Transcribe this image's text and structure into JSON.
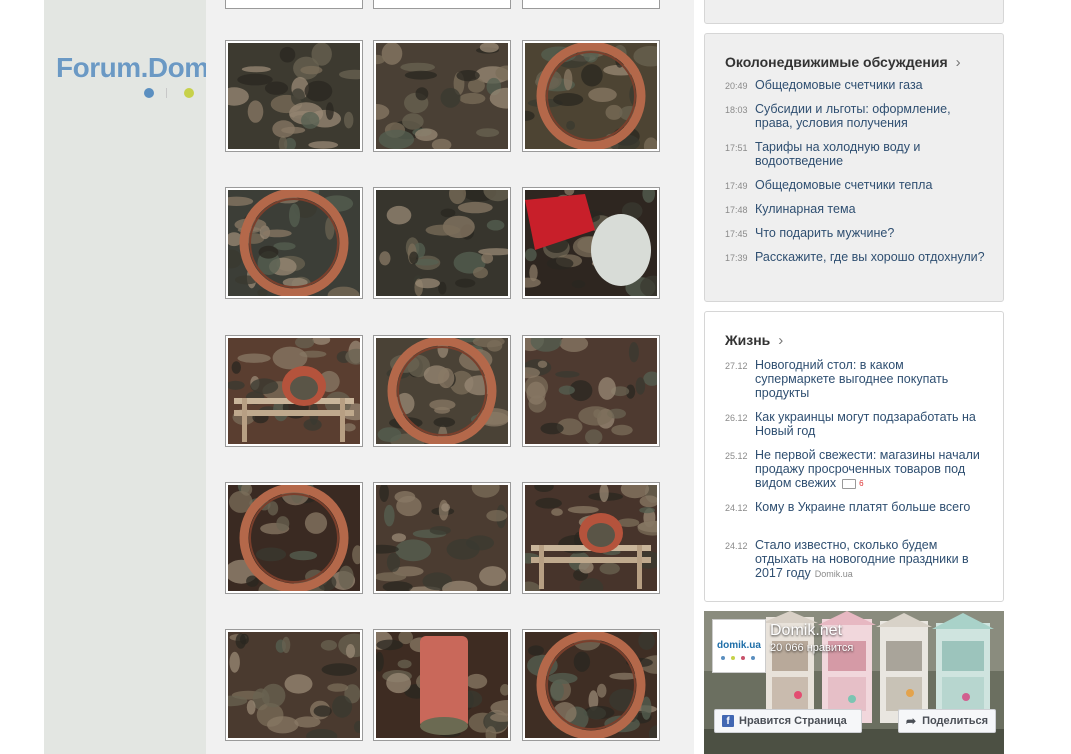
{
  "logo": {
    "text": "Forum.Domik.ua",
    "dot_colors": [
      "#5b8fc0",
      "#c7d14a",
      "#c8536b"
    ]
  },
  "gallery": {
    "photos": [
      {
        "name": "photo-sewage-debris",
        "tone": "#3d3a30"
      },
      {
        "name": "photo-sewage-debris",
        "tone": "#4a4035"
      },
      {
        "name": "photo-pipe-interior",
        "tone": "#4d4433"
      },
      {
        "name": "photo-pipe-cross-section",
        "tone": "#3c3e37"
      },
      {
        "name": "photo-sewage-debris",
        "tone": "#37352d"
      },
      {
        "name": "photo-hand-with-pipe",
        "tone": "#2e2620"
      },
      {
        "name": "photo-pipe-on-bench",
        "tone": "#5a3e30"
      },
      {
        "name": "photo-pipe-cross-section",
        "tone": "#4a4236"
      },
      {
        "name": "photo-sewage-debris",
        "tone": "#4e3a30"
      },
      {
        "name": "photo-pipe-cross-section",
        "tone": "#3a2a22"
      },
      {
        "name": "photo-sewage-debris",
        "tone": "#4b3c31"
      },
      {
        "name": "photo-pipe-on-bench",
        "tone": "#47342b"
      },
      {
        "name": "photo-sewage-debris",
        "tone": "#4a3a2f"
      },
      {
        "name": "photo-pipe-upright",
        "tone": "#3e2c22"
      },
      {
        "name": "photo-pipe-cross-section",
        "tone": "#3f2e24"
      }
    ]
  },
  "discussions": {
    "title": "Околонедвижимые обсуждения",
    "items": [
      {
        "time": "20:49",
        "title": "Общедомовые счетчики газа"
      },
      {
        "time": "18:03",
        "title": "Субсидии и льготы: оформление, права, условия получения"
      },
      {
        "time": "17:51",
        "title": "Тарифы на холодную воду и водоотведение"
      },
      {
        "time": "17:49",
        "title": "Общедомовые счетчики тепла"
      },
      {
        "time": "17:48",
        "title": "Кулинарная тема"
      },
      {
        "time": "17:45",
        "title": "Что подарить мужчине?"
      },
      {
        "time": "17:39",
        "title": "Расскажите, где вы хорошо отдохнули?"
      }
    ]
  },
  "life": {
    "title": "Жизнь",
    "items": [
      {
        "date": "27.12",
        "title": "Новогодний стол: в каком супермаркете выгоднее покупать продукты"
      },
      {
        "date": "26.12",
        "title": "Как украинцы могут подзаработать на Новый год"
      },
      {
        "date": "25.12",
        "title": "Не первой свежести: магазины начали продажу просроченных товаров под видом свежих",
        "comments": "6"
      },
      {
        "date": "24.12",
        "title": "Кому в Украине платят больше всего"
      },
      {
        "date": "24.12",
        "title": "Стало известно, сколько будем отдыхать на новогодние праздники в 2017 году",
        "source": "Domik.ua"
      }
    ]
  },
  "fb": {
    "page_name": "Domik.net",
    "likes": "20 066 нравится",
    "avatar_text": "domik.ua",
    "like_button": "Нравится Страница",
    "share_button": "Поделиться",
    "brand_color": "#4267b2"
  }
}
